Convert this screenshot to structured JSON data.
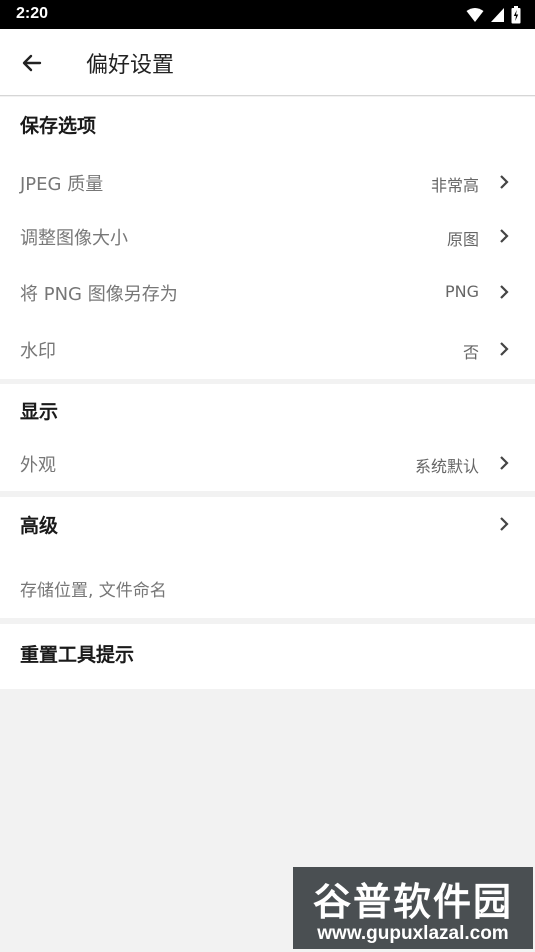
{
  "status_bar": {
    "time": "2:20"
  },
  "app_bar": {
    "title": "偏好设置"
  },
  "save_options": {
    "header": "保存选项",
    "items": [
      {
        "label": "JPEG 质量",
        "value": "非常高"
      },
      {
        "label": "调整图像大小",
        "value": "原图"
      },
      {
        "label": "将 PNG 图像另存为",
        "value": "PNG"
      },
      {
        "label": "水印",
        "value": "否"
      }
    ]
  },
  "display": {
    "header": "显示",
    "items": [
      {
        "label": "外观",
        "value": "系统默认"
      }
    ]
  },
  "advanced": {
    "header": "高级",
    "subtitle": "存储位置, 文件命名"
  },
  "reset": {
    "label": "重置工具提示"
  },
  "watermark": {
    "brand": "谷普软件园",
    "url": "www.gupuxlazal.com"
  }
}
